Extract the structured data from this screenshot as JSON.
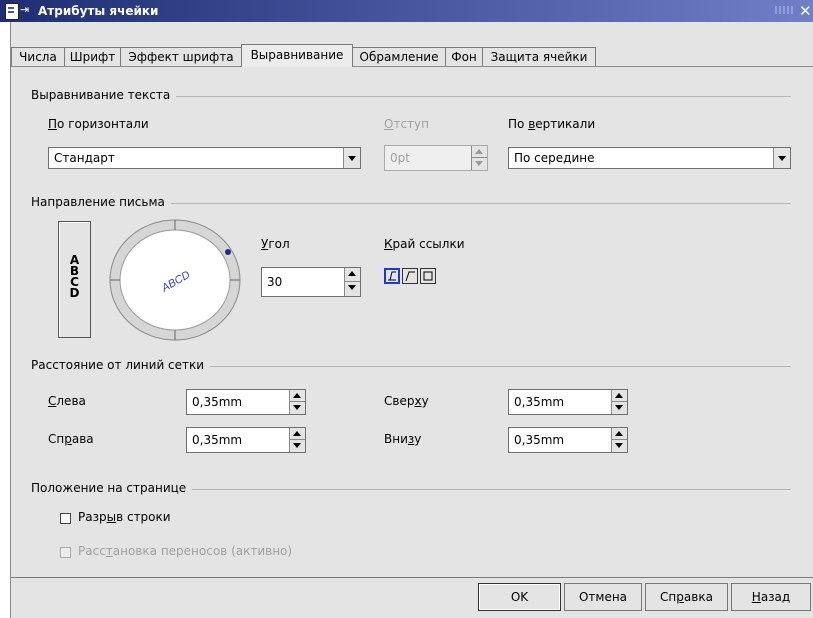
{
  "window": {
    "title": "Атрибуты ячейки",
    "pin_glyph": "⇥",
    "close_glyph": "✕",
    "app_icon": "document-icon"
  },
  "tabs": [
    {
      "label": "Числа"
    },
    {
      "label": "Шрифт"
    },
    {
      "label": "Эффект шрифта"
    },
    {
      "label": "Выравнивание",
      "active": true
    },
    {
      "label": "Обрамление"
    },
    {
      "label": "Фон"
    },
    {
      "label": "Защита ячейки"
    }
  ],
  "text_alignment": {
    "group_title": "Выравнивание текста",
    "horizontal_label_key": "П",
    "horizontal_label_rest": "о горизонтали",
    "horizontal_value": "Стандарт",
    "indent_label_key": "О",
    "indent_label_rest": "тступ",
    "indent_value": "0pt",
    "vertical_label_pre": "По ",
    "vertical_label_key": "в",
    "vertical_label_rest": "ертикали",
    "vertical_value": "По середине"
  },
  "text_direction": {
    "group_title": "Направление письма",
    "vertical_stacked_letters": [
      "A",
      "B",
      "C",
      "D"
    ],
    "dial_text": "ABCD",
    "angle_label_key": "У",
    "angle_label_rest": "гол",
    "angle_value": "30",
    "reference_edge_label_key": "К",
    "reference_edge_label_rest": "рай ссылки"
  },
  "grid_spacing": {
    "group_title": "Расстояние от линий сетки",
    "left_label_key": "С",
    "left_label_rest": "лева",
    "left_value": "0,35mm",
    "right_label_pre": "Сп",
    "right_label_key": "р",
    "right_label_rest": "ава",
    "right_value": "0,35mm",
    "top_label_pre": "Свер",
    "top_label_key": "х",
    "top_label_rest": "у",
    "top_value": "0,35mm",
    "bottom_label_pre": "Вни",
    "bottom_label_key": "з",
    "bottom_label_rest": "у",
    "bottom_value": "0,35mm"
  },
  "page_position": {
    "group_title": "Положение на странице",
    "wrap_label_pre": "Разр",
    "wrap_label_key": "ы",
    "wrap_label_rest": "в строки",
    "hyphen_label_pre": "Расс",
    "hyphen_label_key": "т",
    "hyphen_label_rest": "ановка переносов (активно)"
  },
  "buttons": {
    "ok": "OK",
    "cancel": "Отмена",
    "help_pre": "Сп",
    "help_key": "р",
    "help_rest": "авка",
    "back_key": "Н",
    "back_rest": "азад"
  },
  "colors": {
    "titlebar_start": "#1e2e74",
    "titlebar_end": "#6f7fc8",
    "dialog_bg": "#e4e4e4",
    "selection_blue": "#1c3ad0"
  }
}
